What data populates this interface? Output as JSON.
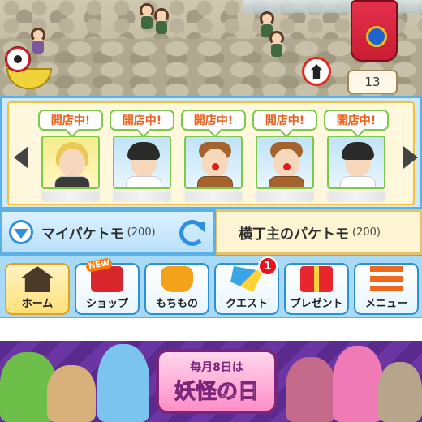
{
  "scene": {
    "counter_value": "13"
  },
  "friends": {
    "status_label": "開店中!",
    "items": [
      {
        "status": "開店中!",
        "variant": "blond"
      },
      {
        "status": "開店中!",
        "variant": "boy"
      },
      {
        "status": "開店中!",
        "variant": "deer"
      },
      {
        "status": "開店中!",
        "variant": "deer"
      },
      {
        "status": "開店中!",
        "variant": "boy"
      }
    ]
  },
  "tabs": {
    "my_label": "マイパケトモ",
    "my_count": "(200)",
    "yokocho_label": "横丁主のパケトモ",
    "yokocho_count": "(200)"
  },
  "nav": {
    "home": "ホーム",
    "shop": "ショップ",
    "shop_new": "NEW",
    "items": "もちもの",
    "quest": "クエスト",
    "quest_badge": "1",
    "present": "プレゼント",
    "menu": "メニュー"
  },
  "banner": {
    "subtitle": "毎月8日は",
    "title": "妖怪の日"
  }
}
